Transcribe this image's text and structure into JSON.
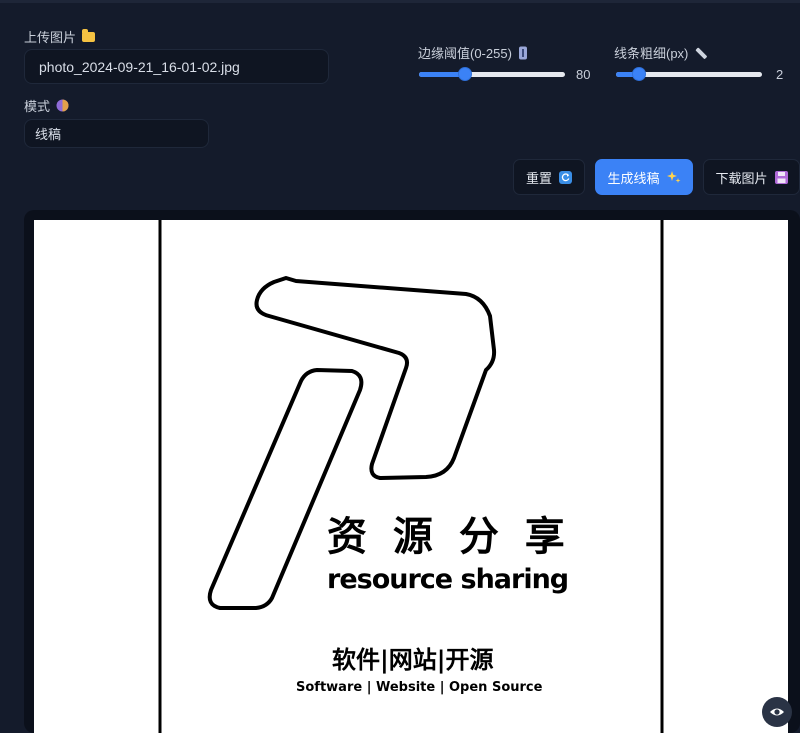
{
  "upload": {
    "label": "上传图片",
    "file_name": "photo_2024-09-21_16-01-02.jpg"
  },
  "mode": {
    "label": "模式",
    "value": "线稿"
  },
  "edge_threshold": {
    "label": "边缘阈值(0-255)",
    "value": "80",
    "fraction": 0.314
  },
  "line_width": {
    "label": "线条粗细(px)",
    "value": "2",
    "fraction": 0.16
  },
  "buttons": {
    "reset": "重置",
    "generate": "生成线稿",
    "download": "下载图片"
  },
  "preview": {
    "title_cn": "资 源 分 享",
    "title_en": "resource sharing",
    "subtitle_cn": "软件|网站|开源",
    "subtitle_en": "Software | Website | Open Source"
  },
  "icons": {
    "upload": "folder-icon",
    "mode": "palette-icon",
    "threshold": "thermometer-icon",
    "line_width": "ruler-icon",
    "reset": "refresh-icon",
    "generate": "sparkles-icon",
    "download": "floppy-disk-icon",
    "preview_toggle": "eye-icon"
  },
  "colors": {
    "background": "#141b2b",
    "panel": "#0f1522",
    "accent": "#3b82f6",
    "canvas": "#ffffff"
  }
}
